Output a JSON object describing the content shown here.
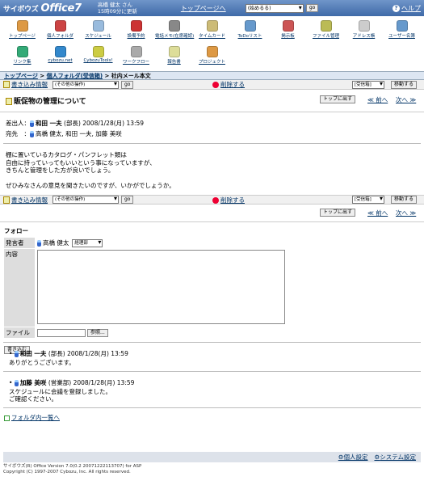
{
  "header": {
    "logo_brand": "サイボウズ",
    "logo_product": "Office7",
    "user_name": "高橋 健太 さん",
    "updated": "15時09分に更新",
    "top_link": "トップページへ",
    "select_value": "(始めるる)",
    "go_label": "go",
    "help_label": "ヘルプ"
  },
  "apps": [
    {
      "label": "トップページ",
      "icon": "house-icon",
      "color": "#d94"
    },
    {
      "label": "個人フォルダ",
      "icon": "folder-icon",
      "color": "#c44"
    },
    {
      "label": "スケジュール",
      "icon": "schedule-icon",
      "color": "#9bd"
    },
    {
      "label": "設備予約",
      "icon": "car-icon",
      "color": "#c33"
    },
    {
      "label": "電話メモ(在席確認)",
      "icon": "phone-icon",
      "color": "#888"
    },
    {
      "label": "タイムカード",
      "icon": "timecard-icon",
      "color": "#cb7"
    },
    {
      "label": "ToDoリスト",
      "icon": "todo-icon",
      "color": "#69c"
    },
    {
      "label": "掲示板",
      "icon": "board-icon",
      "color": "#c55"
    },
    {
      "label": "ファイル管理",
      "icon": "file-icon",
      "color": "#bb5"
    },
    {
      "label": "アドレス帳",
      "icon": "address-icon",
      "color": "#ccc"
    },
    {
      "label": "ユーザー名簿",
      "icon": "users-icon",
      "color": "#69c"
    },
    {
      "label": "リンク集",
      "icon": "globe-icon",
      "color": "#3a7"
    },
    {
      "label": "cybozu.net",
      "icon": "cybozu-net-icon",
      "color": "#38c"
    },
    {
      "label": "CybozuTools!",
      "icon": "tools-icon",
      "color": "#cc4"
    },
    {
      "label": "ワークフロー",
      "icon": "workflow-icon",
      "color": "#aaa"
    },
    {
      "label": "報告書",
      "icon": "report-icon",
      "color": "#dd9"
    },
    {
      "label": "プロジェクト",
      "icon": "project-icon",
      "color": "#d94"
    }
  ],
  "breadcrumb": {
    "top": "トップページ",
    "folder": "個人フォルダ(受信箱)",
    "current": "社内メール本文"
  },
  "action": {
    "write_info": "書き込み情報",
    "op_select": "(その他の操作)",
    "go": "go",
    "delete": "削除する",
    "folder_select": "[受信箱]",
    "move": "移動する"
  },
  "message": {
    "title": "販促物の管理について",
    "top_button": "トップに出す",
    "prev": "≪ 前へ",
    "next": "次へ ≫",
    "sender_label": "差出人：",
    "sender_name": "和田 一夫",
    "sender_role": "(部長)",
    "sender_date": "2008/1/28(月) 13:59",
    "to_label": "宛先　：",
    "recipients": "高橋 健太, 和田 一夫, 加藤 美咲",
    "body": [
      "棚に置いているカタログ・パンフレット類は",
      "自由に持っていってもいいという事になっていますが、",
      "きちんと管理をした方が良いでしょう。",
      "",
      "ぜひみなさんの意見を聞きたいのですが、いかがでしょうか。"
    ]
  },
  "follow": {
    "title": "フォロー",
    "poster_label": "発言者",
    "poster_name": "高橋 健太",
    "dept_select": "経理部",
    "content_label": "内容",
    "file_label": "ファイル",
    "browse": "参照...",
    "submit": "書き込む"
  },
  "replies": [
    {
      "name": "和田 一夫",
      "role": "(部長)",
      "date": "2008/1/28(月) 13:59",
      "text": [
        "ありがとうございます。"
      ]
    },
    {
      "name": "加藤 美咲",
      "role": "(営業部)",
      "date": "2008/1/28(月) 13:59",
      "text": [
        "スケジュールに会議を登録しました。",
        "ご確認ください。"
      ]
    }
  ],
  "folder_list_link": "フォルダ内一覧へ",
  "bottom": {
    "personal": "個人設定",
    "system": "システム設定"
  },
  "footer": {
    "line1": "サイボウズ(R) Office Version 7.0(0.2 20071222113707) for ASP",
    "line2": "Copyright (C) 1997-2007 Cybozu, Inc. All rights reserved."
  }
}
